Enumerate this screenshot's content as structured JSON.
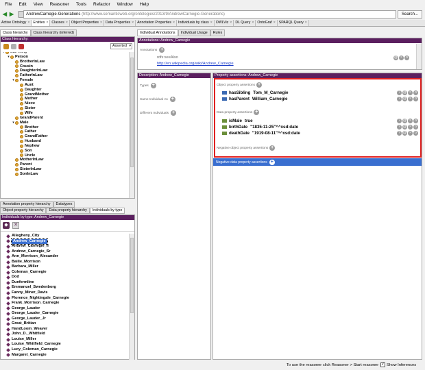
{
  "menu": [
    "File",
    "Edit",
    "View",
    "Reasoner",
    "Tools",
    "Refactor",
    "Window",
    "Help"
  ],
  "address": {
    "name": "AndrewCarnegie-Generations",
    "uri": "(http://www.semanticweb.org/ontologies/2013/9/AndrewCarnegie-Generations)",
    "search": "Search..."
  },
  "tabs": [
    {
      "label": "Active Ontology",
      "close": "×"
    },
    {
      "label": "Entities",
      "close": "×"
    },
    {
      "label": "Classes",
      "close": "×"
    },
    {
      "label": "Object Properties",
      "close": "×"
    },
    {
      "label": "Data Properties",
      "close": "×"
    },
    {
      "label": "Annotation Properties",
      "close": "×"
    },
    {
      "label": "Individuals by class",
      "close": "×"
    },
    {
      "label": "OWLViz",
      "close": "×"
    },
    {
      "label": "DL Query",
      "close": "×"
    },
    {
      "label": "OntoGraf",
      "close": "×"
    },
    {
      "label": "SPARQL Query",
      "close": "×"
    }
  ],
  "left_tabs": {
    "a": "Class hierarchy",
    "b": "Class hierarchy (inferred)"
  },
  "class_panel": {
    "title": "Class hierarchy:",
    "asserted": "Asserted"
  },
  "classes": [
    {
      "label": "owl:Thing",
      "indent": 0,
      "tog": "▾",
      "partial": true
    },
    {
      "label": "Person",
      "indent": 1,
      "tog": "▾",
      "bold": true
    },
    {
      "label": "BrotherInLaw",
      "indent": 2,
      "bold": true
    },
    {
      "label": "Cousin",
      "indent": 2,
      "bold": true
    },
    {
      "label": "DaughterInLaw",
      "indent": 2,
      "bold": true
    },
    {
      "label": "FatherInLaw",
      "indent": 2,
      "bold": true
    },
    {
      "label": "Female",
      "indent": 2,
      "tog": "▾",
      "bold": true
    },
    {
      "label": "Aunt",
      "indent": 3,
      "bold": true
    },
    {
      "label": "Daughter",
      "indent": 3,
      "bold": true
    },
    {
      "label": "GrandMother",
      "indent": 3,
      "bold": true
    },
    {
      "label": "Mother",
      "indent": 3,
      "bold": true
    },
    {
      "label": "Niece",
      "indent": 3,
      "bold": true
    },
    {
      "label": "Sister",
      "indent": 3,
      "bold": true
    },
    {
      "label": "Wife",
      "indent": 3,
      "bold": true
    },
    {
      "label": "GrandParent",
      "indent": 2,
      "bold": true
    },
    {
      "label": "Male",
      "indent": 2,
      "tog": "▾",
      "bold": true
    },
    {
      "label": "Brother",
      "indent": 3,
      "bold": true
    },
    {
      "label": "Father",
      "indent": 3,
      "bold": true
    },
    {
      "label": "GrandFather",
      "indent": 3,
      "bold": true
    },
    {
      "label": "Husband",
      "indent": 3,
      "bold": true
    },
    {
      "label": "Nephew",
      "indent": 3,
      "bold": true
    },
    {
      "label": "Son",
      "indent": 3,
      "bold": true
    },
    {
      "label": "Uncle",
      "indent": 3,
      "bold": true
    },
    {
      "label": "MotherInLaw",
      "indent": 2,
      "bold": true
    },
    {
      "label": "Parent",
      "indent": 2,
      "bold": true
    },
    {
      "label": "SisterInLaw",
      "indent": 2,
      "bold": true
    },
    {
      "label": "SonInLaw",
      "indent": 2,
      "bold": true
    }
  ],
  "lower_tabs": {
    "row1": [
      "Annotation property hierarchy",
      "Datatypes"
    ],
    "row2": [
      "Object property hierarchy",
      "Data property hierarchy",
      "Individuals by type"
    ]
  },
  "individuals_panel": {
    "title": "Individuals by type: Andrew_Carnegie"
  },
  "individuals": [
    "Allegheny_City",
    "Andrew_Carnegie",
    "Andrew_Carnegie_II",
    "Andrew_Carnegie_Sr",
    "Ann_Morrison_Alexander",
    "Bailie_Morrison",
    "Barbara_Miller",
    "Coleman_Carnegie",
    "Dod",
    "Dunfermline",
    "Emmanuel_Swedenborg",
    "Fanny_Miner_Davis",
    "Florence_Nightingale_Carnegie",
    "Frank_Morrison_Carnegie",
    "George_Lauder",
    "George_Lauder_Carnegie",
    "George_Lauder_Jr",
    "Great_Britian",
    "HandLoom_Weaver",
    "John_D._Whitfield",
    "Louise_Miller",
    "Louise_Whitfield_Carnegie",
    "Lucy_Coleman_Carnegie",
    "Margaret_Carnegie"
  ],
  "right_tabs": [
    "Individual Annotations",
    "Individual Usage",
    "Rules"
  ],
  "annotations": {
    "title": "Annotations: Andrew_Carnegie",
    "label": "Annotations",
    "prop": "rdfs:seeAlso",
    "link": "http://en.wikipedia.org/wiki/Andrew_Carnegie"
  },
  "description": {
    "title": "Description: Andrew_Carnegie",
    "types": "Types",
    "same": "Same Individual As",
    "different": "Different Individuals"
  },
  "assertions": {
    "title": "Property assertions: Andrew_Carnegie",
    "obj_label": "Object property assertions",
    "obj": [
      {
        "prop": "hasSibling",
        "value": "Tom_M_Carnegie"
      },
      {
        "prop": "hasParent",
        "value": "William_Carnegie"
      }
    ],
    "data_label": "Data property assertions",
    "data": [
      {
        "prop": "isMale",
        "value": "true"
      },
      {
        "prop": "birthDate",
        "value": "\"1835-11-25\"^^xsd:date"
      },
      {
        "prop": "deathDate",
        "value": "\"1919-08-11\"^^xsd:date"
      }
    ],
    "neg_obj": "Negative object property assertions",
    "neg_data": "Negative data property assertions"
  },
  "status": {
    "text": "To use the reasoner click Reasoner > Start reasoner",
    "checkbox": "Show Inferences"
  },
  "colors": {
    "title_bar": "#5b1f5f",
    "highlight": "#e02020",
    "selection": "#3a6fd0"
  }
}
